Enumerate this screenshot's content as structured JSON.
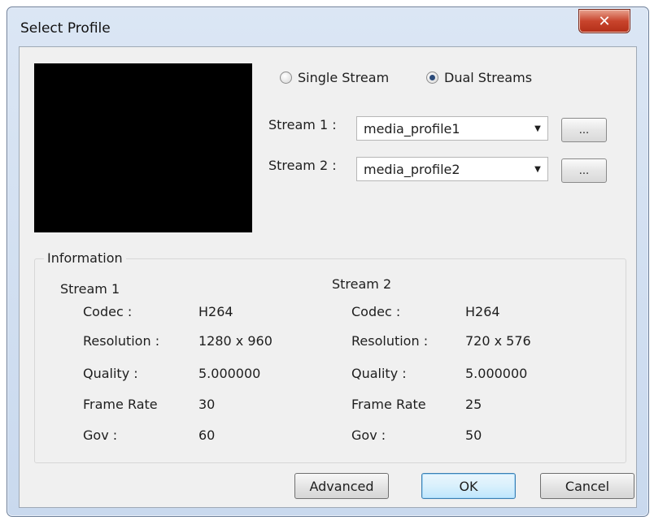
{
  "window": {
    "title": "Select Profile",
    "close_label": "x"
  },
  "mode": {
    "single_label": "Single Stream",
    "dual_label": "Dual Streams",
    "selected": "Dual Streams"
  },
  "streams": [
    {
      "label": "Stream 1 :",
      "value": "media_profile1",
      "browse_label": "..."
    },
    {
      "label": "Stream 2 :",
      "value": "media_profile2",
      "browse_label": "..."
    }
  ],
  "information": {
    "title": "Information",
    "columns": [
      {
        "heading": "Stream 1",
        "rows": [
          {
            "key": "Codec :",
            "value": "H264"
          },
          {
            "key": "Resolution :",
            "value": "1280 x 960"
          },
          {
            "key": "Quality :",
            "value": "5.000000"
          },
          {
            "key": "Frame Rate",
            "value": "30"
          },
          {
            "key": "Gov :",
            "value": "60"
          }
        ]
      },
      {
        "heading": "Stream 2",
        "rows": [
          {
            "key": "Codec :",
            "value": "H264"
          },
          {
            "key": "Resolution :",
            "value": "720 x 576"
          },
          {
            "key": "Quality :",
            "value": "5.000000"
          },
          {
            "key": "Frame Rate",
            "value": "25"
          },
          {
            "key": "Gov :",
            "value": "50"
          }
        ]
      }
    ]
  },
  "buttons": {
    "advanced": "Advanced",
    "ok": "OK",
    "cancel": "Cancel"
  },
  "icons": {
    "close": "close-icon",
    "dropdown": "chevron-down-icon"
  }
}
